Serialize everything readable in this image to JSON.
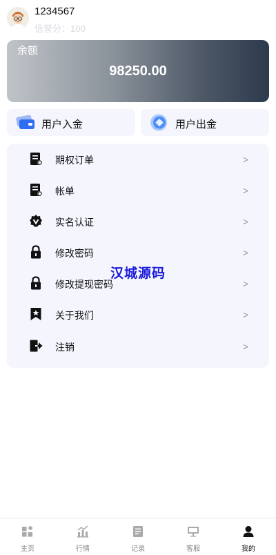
{
  "header": {
    "username": "1234567",
    "credit_text": "信誉分：100"
  },
  "balance": {
    "label": "余额",
    "value": "98250.00"
  },
  "actions": [
    {
      "label": "用户入金",
      "icon": "card-icon"
    },
    {
      "label": "用户出金",
      "icon": "coin-icon"
    }
  ],
  "menu": {
    "items": [
      {
        "label": "期权订单",
        "arrow": ">",
        "icon": "order-doc-icon"
      },
      {
        "label": "帐单",
        "arrow": ">",
        "icon": "bill-doc-icon"
      },
      {
        "label": "实名认证",
        "arrow": ">",
        "icon": "verified-badge-icon"
      },
      {
        "label": "修改密码",
        "arrow": ">",
        "icon": "lock-icon"
      },
      {
        "label": "修改提现密码",
        "arrow": ">",
        "icon": "lock-icon"
      },
      {
        "label": "关于我们",
        "arrow": ">",
        "icon": "bookmark-star-icon"
      },
      {
        "label": "注销",
        "arrow": ">",
        "icon": "logout-icon"
      }
    ]
  },
  "watermark": "汉城源码",
  "tabbar": {
    "items": [
      {
        "label": "主页",
        "icon": "home-grid-icon",
        "active": false
      },
      {
        "label": "行情",
        "icon": "chart-icon",
        "active": false
      },
      {
        "label": "记录",
        "icon": "record-icon",
        "active": false
      },
      {
        "label": "客服",
        "icon": "support-monitor-icon",
        "active": false
      },
      {
        "label": "我的",
        "icon": "user-icon",
        "active": true
      }
    ]
  },
  "colors": {
    "accent_blue": "#2f7bf5",
    "card_dark": "#2c3a4d",
    "watermark": "#1a1adb",
    "panel_bg": "#f5f6fd"
  }
}
